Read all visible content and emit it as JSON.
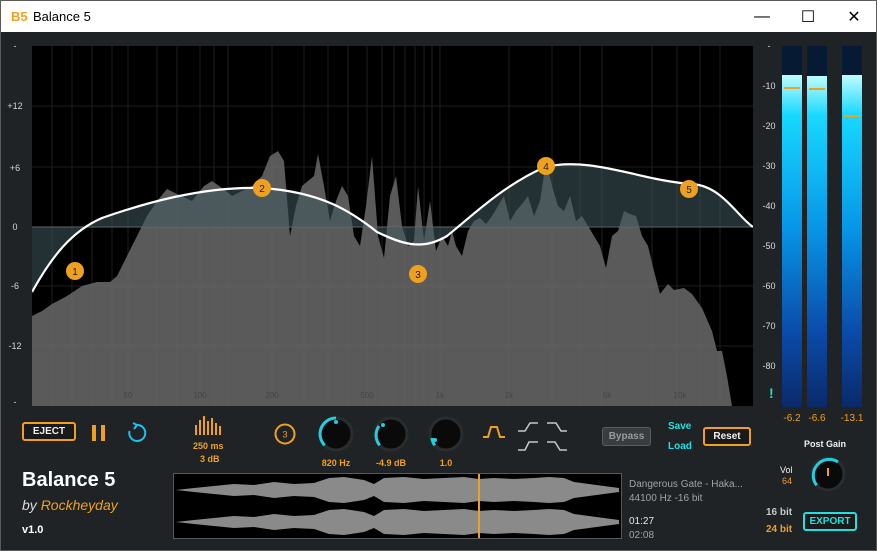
{
  "window": {
    "logo": "B5",
    "title": "Balance 5",
    "minimize": "—",
    "maximize": "☐",
    "close": "✕"
  },
  "eq": {
    "db_labels": [
      "-",
      "+12",
      "+6",
      "0",
      "-6",
      "-12",
      "-"
    ],
    "freq_labels": [
      "50",
      "100",
      "200",
      "500",
      "1k",
      "2k",
      "5k",
      "10k"
    ],
    "bands": [
      {
        "label": "1",
        "freq_hz": 40,
        "gain_db": -4
      },
      {
        "label": "2",
        "freq_hz": 200,
        "gain_db": 4
      },
      {
        "label": "3",
        "freq_hz": 820,
        "gain_db": -4.9
      },
      {
        "label": "4",
        "freq_hz": 2600,
        "gain_db": 6
      },
      {
        "label": "5",
        "freq_hz": 7500,
        "gain_db": 4
      }
    ],
    "colors": {
      "accent": "#f0a020",
      "curve": "#ffffff",
      "spectrum": "#6a6a6a"
    }
  },
  "meters": {
    "scale": [
      "-",
      "-10",
      "-20",
      "-30",
      "-40",
      "-50",
      "-60",
      "-70",
      "-80"
    ],
    "channels": [
      {
        "value_text": "-6.2",
        "level_db": -6.2,
        "peak_db": -6.2
      },
      {
        "value_text": "-6.6",
        "level_db": -6.6,
        "peak_db": -6.6
      },
      {
        "value_text": "-13.1",
        "level_db": -6.2,
        "peak_db": -13.1
      }
    ],
    "warning": "!"
  },
  "controls": {
    "eject": "EJECT",
    "window_ms": "250 ms",
    "window_db": "3 dB",
    "band_number": "3",
    "freq": "820 Hz",
    "gain": "-4.9 dB",
    "q": "1.0",
    "bypass": "Bypass",
    "save": "Save",
    "load": "Load",
    "reset": "Reset"
  },
  "output": {
    "post_gain_label": "Post Gain",
    "vol_label": "Vol",
    "vol_value": "64",
    "bit16": "16 bit",
    "bit24": "24 bit",
    "export": "EXPORT"
  },
  "track": {
    "name": "Dangerous Gate - Haka...",
    "format": "44100 Hz -16 bit",
    "position": "01:27",
    "duration": "02:08",
    "position_fraction": 0.68
  },
  "branding": {
    "title": "Balance 5",
    "by": "by",
    "author": "Rockheyday",
    "version": "v1.0"
  }
}
